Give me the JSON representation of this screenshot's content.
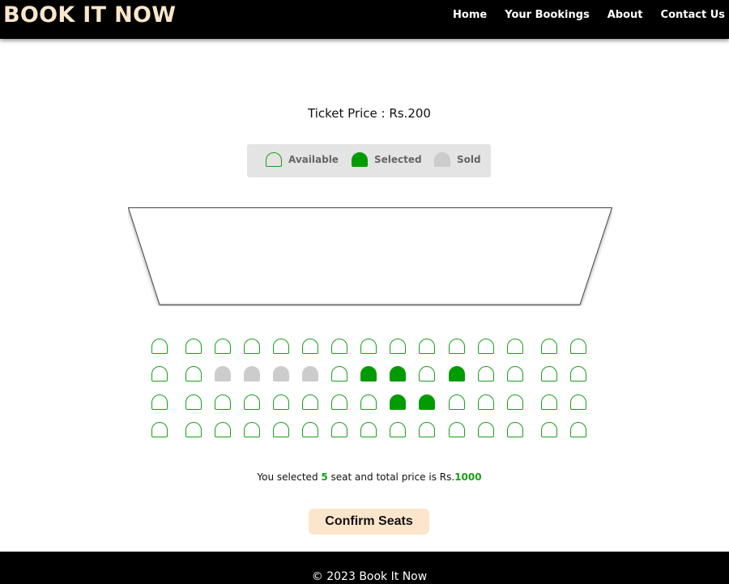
{
  "brand": "BOOK IT NOW",
  "nav": {
    "items": [
      "Home",
      "Your Bookings",
      "About",
      "Contact Us"
    ]
  },
  "ticket": {
    "price_text": "Ticket Price : Rs.200"
  },
  "legend": {
    "available": "Available",
    "selected": "Selected",
    "sold": "Sold"
  },
  "colors": {
    "brand": "#fbe6cc",
    "available_outline": "#1a9f1a",
    "selected": "#029b02",
    "sold": "#cccccc",
    "legend_bg": "#e4e4e4",
    "confirm_bg": "#fbe6cc"
  },
  "seats": {
    "rows": [
      [
        "available",
        "available",
        "available",
        "available",
        "available",
        "available",
        "available",
        "available",
        "available",
        "available",
        "available",
        "available",
        "available",
        "available",
        "available"
      ],
      [
        "available",
        "available",
        "sold",
        "sold",
        "sold",
        "sold",
        "available",
        "selected",
        "selected",
        "available",
        "selected",
        "available",
        "available",
        "available",
        "available"
      ],
      [
        "available",
        "available",
        "available",
        "available",
        "available",
        "available",
        "available",
        "available",
        "selected",
        "selected",
        "available",
        "available",
        "available",
        "available",
        "available"
      ],
      [
        "available",
        "available",
        "available",
        "available",
        "available",
        "available",
        "available",
        "available",
        "available",
        "available",
        "available",
        "available",
        "available",
        "available",
        "available"
      ]
    ]
  },
  "summary": {
    "prefix": "You selected ",
    "count": "5",
    "middle": " seat and total price is Rs.",
    "total": "1000"
  },
  "confirm_label": "Confirm Seats",
  "footer_text": "© 2023 Book It Now"
}
